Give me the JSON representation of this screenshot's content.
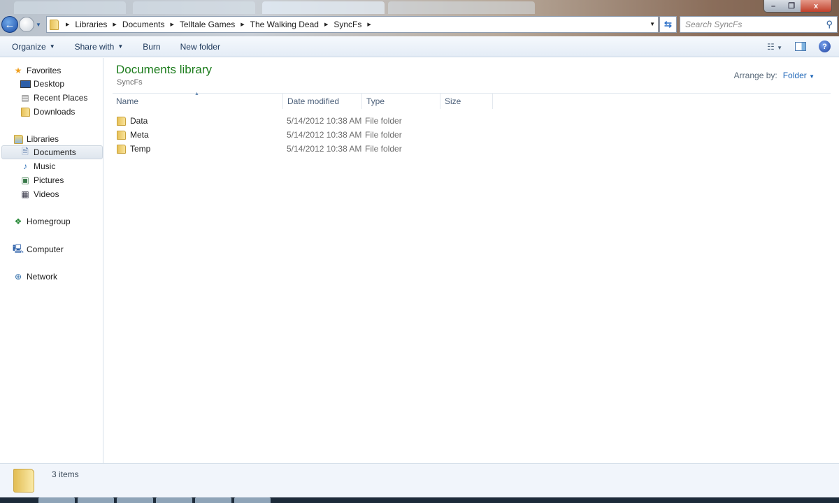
{
  "window": {
    "minimize_icon": "minimize-icon",
    "maximize_icon": "restore-icon",
    "close_label": "x"
  },
  "address": {
    "crumbs": [
      "Libraries",
      "Documents",
      "Telltale Games",
      "The Walking Dead",
      "SyncFs"
    ]
  },
  "search": {
    "placeholder": "Search SyncFs"
  },
  "toolbar": {
    "organize": "Organize",
    "share_with": "Share with",
    "burn": "Burn",
    "new_folder": "New folder"
  },
  "sidebar": {
    "favorites": "Favorites",
    "desktop": "Desktop",
    "recent_places": "Recent Places",
    "downloads": "Downloads",
    "libraries": "Libraries",
    "documents": "Documents",
    "music": "Music",
    "pictures": "Pictures",
    "videos": "Videos",
    "homegroup": "Homegroup",
    "computer": "Computer",
    "network": "Network"
  },
  "main": {
    "title": "Documents library",
    "subtitle": "SyncFs",
    "arrange_label": "Arrange by:",
    "arrange_value": "Folder",
    "columns": [
      "Name",
      "Date modified",
      "Type",
      "Size"
    ],
    "rows": [
      {
        "name": "Data",
        "date": "5/14/2012 10:38 AM",
        "type": "File folder"
      },
      {
        "name": "Meta",
        "date": "5/14/2012 10:38 AM",
        "type": "File folder"
      },
      {
        "name": "Temp",
        "date": "5/14/2012 10:38 AM",
        "type": "File folder"
      }
    ]
  },
  "status": {
    "items": "3 items"
  }
}
